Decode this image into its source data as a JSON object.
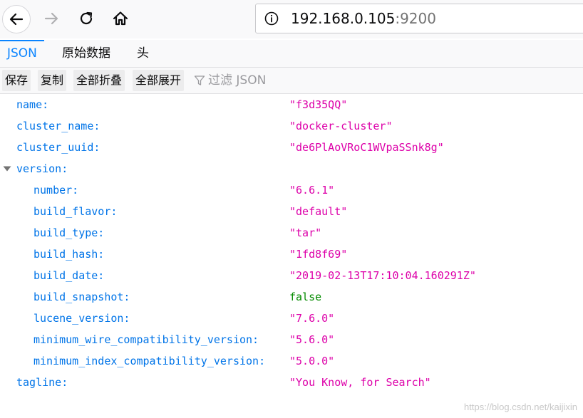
{
  "browser": {
    "url_host": "192.168.0.105",
    "url_port": ":9200"
  },
  "viewer": {
    "tabs": [
      {
        "label": "JSON",
        "active": true
      },
      {
        "label": "原始数据",
        "active": false
      },
      {
        "label": "头",
        "active": false
      }
    ],
    "toolbar": {
      "save": "保存",
      "copy": "复制",
      "collapse_all": "全部折叠",
      "expand_all": "全部展开",
      "filter_placeholder": "过滤 JSON"
    }
  },
  "json_rows": [
    {
      "key": "name:",
      "value": "\"f3d35QQ\"",
      "type": "string",
      "level": 0
    },
    {
      "key": "cluster_name:",
      "value": "\"docker-cluster\"",
      "type": "string",
      "level": 0
    },
    {
      "key": "cluster_uuid:",
      "value": "\"de6PlAoVRoC1WVpaSSnk8g\"",
      "type": "string",
      "level": 0
    },
    {
      "key": "version:",
      "value": "",
      "type": "object",
      "level": 0,
      "expanded": true
    },
    {
      "key": "number:",
      "value": "\"6.6.1\"",
      "type": "string",
      "level": 1
    },
    {
      "key": "build_flavor:",
      "value": "\"default\"",
      "type": "string",
      "level": 1
    },
    {
      "key": "build_type:",
      "value": "\"tar\"",
      "type": "string",
      "level": 1
    },
    {
      "key": "build_hash:",
      "value": "\"1fd8f69\"",
      "type": "string",
      "level": 1
    },
    {
      "key": "build_date:",
      "value": "\"2019-02-13T17:10:04.160291Z\"",
      "type": "string",
      "level": 1
    },
    {
      "key": "build_snapshot:",
      "value": "false",
      "type": "boolean",
      "level": 1
    },
    {
      "key": "lucene_version:",
      "value": "\"7.6.0\"",
      "type": "string",
      "level": 1
    },
    {
      "key": "minimum_wire_compatibility_version:",
      "value": "\"5.6.0\"",
      "type": "string",
      "level": 1
    },
    {
      "key": "minimum_index_compatibility_version:",
      "value": "\"5.0.0\"",
      "type": "string",
      "level": 1
    },
    {
      "key": "tagline:",
      "value": "\"You Know, for Search\"",
      "type": "string",
      "level": 0
    }
  ],
  "icons": {
    "back": "back-arrow-icon",
    "forward": "forward-arrow-icon",
    "reload": "reload-icon",
    "home": "home-icon",
    "site_info": "info-icon",
    "filter": "filter-funnel-icon",
    "expand": "expand-triangle-icon"
  },
  "colors": {
    "key": "#0074e8",
    "string": "#dd00a9",
    "boolean": "#058b00",
    "active_tab": "#0a84ff"
  },
  "watermark": "https://blog.csdn.net/kaijixin"
}
